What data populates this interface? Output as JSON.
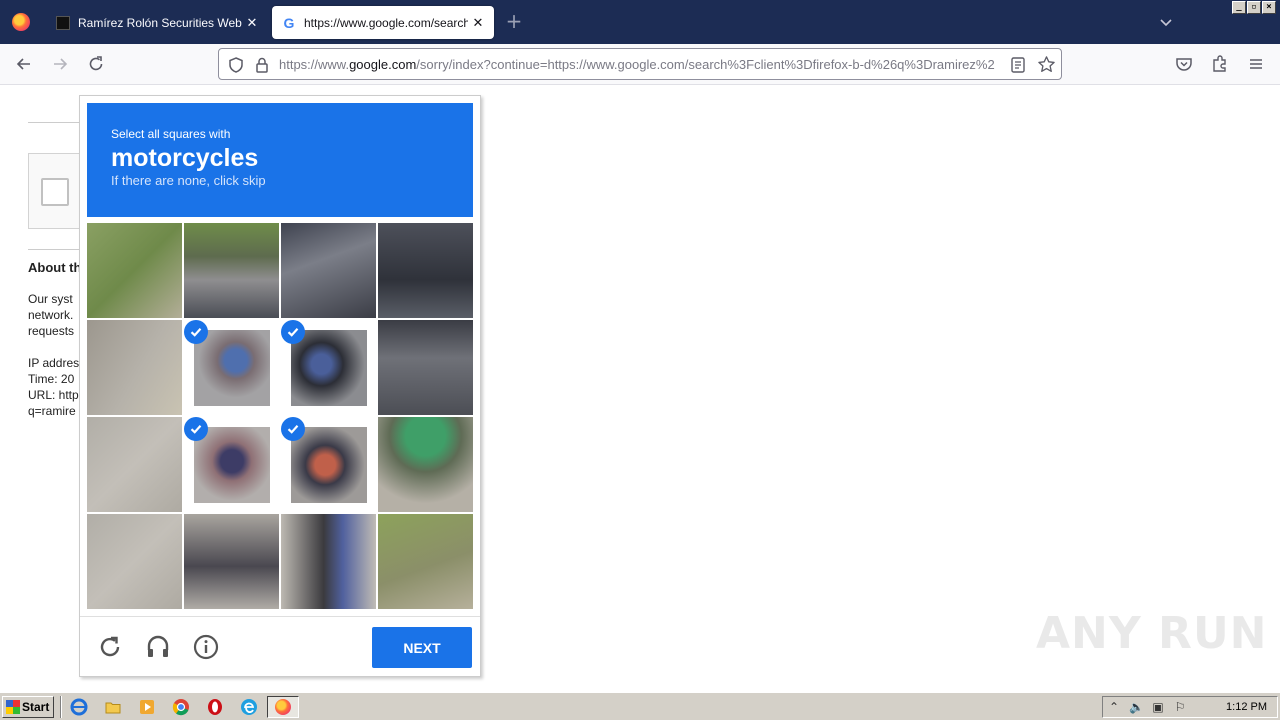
{
  "browser": {
    "tabs": [
      {
        "title": "Ramírez Rolón Securities Website |",
        "close": "✕",
        "active": false
      },
      {
        "title": "https://www.google.com/search?c",
        "close": "✕",
        "active": true
      }
    ],
    "new_tab": "+",
    "url": {
      "prefix": "https://www.",
      "host": "google.com",
      "rest": "/sorry/index?continue=https://www.google.com/search%3Fclient%3Dfirefox-b-d%26q%3Dramirez%2"
    },
    "icons": [
      "firefox-logo",
      "back-arrow",
      "forward-arrow",
      "reload",
      "shield",
      "lock",
      "reader-view",
      "bookmark-star",
      "pocket",
      "extensions",
      "hamburger-menu",
      "list-all-tabs"
    ],
    "window_buttons": [
      "_",
      "▫",
      "×"
    ]
  },
  "page": {
    "about_heading": "About th",
    "body_lines": [
      "Our syst",
      "network.",
      "requests"
    ],
    "ip_line": "IP addres",
    "time_line": "Time: 20",
    "url_line": "URL: http",
    "q_line": "q=ramire"
  },
  "captcha": {
    "line1": "Select all squares with",
    "keyword": "motorcycles",
    "line3": "If there are none, click skip",
    "next_label": "NEXT",
    "grid_rows": 4,
    "grid_cols": 4,
    "selected_tiles": [
      5,
      6,
      9,
      10
    ],
    "tiles": [
      "grass-roadside",
      "truck-bed",
      "dark-truck",
      "dark-truck-side",
      "road-edge",
      "rider-motorcycle",
      "rider-truck-grille",
      "truck-grille",
      "road",
      "motorcycle-front",
      "motorcycle-front-red",
      "green-barrel-rocks",
      "road",
      "motorcycle-wheel",
      "motorcycle-tire",
      "grass-rocks"
    ],
    "footer_icons": [
      "reload-icon",
      "audio-headphones-icon",
      "info-icon"
    ]
  },
  "watermark": "ANY RUN",
  "taskbar": {
    "start_label": "Start",
    "quicklaunch": [
      "ie-icon",
      "folder-icon",
      "media-player-icon",
      "chrome-icon",
      "opera-icon",
      "edge-icon",
      "firefox-icon"
    ],
    "clock": "1:12 PM"
  }
}
